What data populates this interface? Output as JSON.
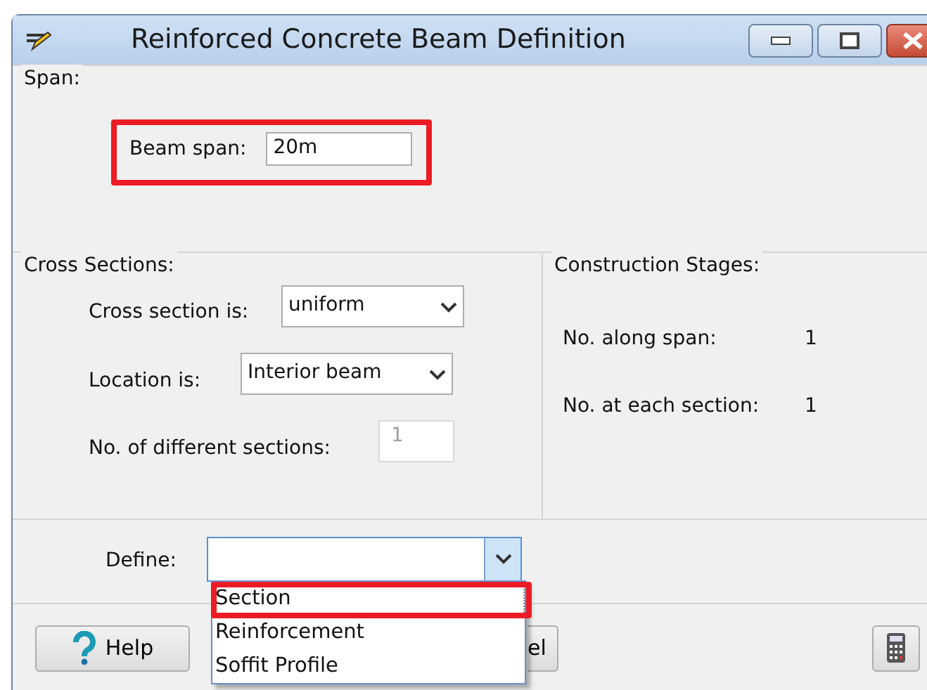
{
  "window": {
    "title": "Reinforced Concrete Beam Definition"
  },
  "span": {
    "legend": "Span:",
    "beam_span_label": "Beam span:",
    "beam_span_value": "20m",
    "highlighted": true
  },
  "cross_sections": {
    "legend": "Cross Sections:",
    "fields": [
      {
        "kind": "select",
        "label": "Cross section is:",
        "value": "uniform"
      },
      {
        "kind": "select",
        "label": "Location is:",
        "value": "Interior beam"
      },
      {
        "kind": "input",
        "label": "No. of different sections:",
        "value": "1",
        "disabled": true
      }
    ]
  },
  "construction_stages": {
    "legend": "Construction Stages:",
    "rows": [
      {
        "label": "No. along span:",
        "value": "1"
      },
      {
        "label": "No. at each section:",
        "value": "1"
      }
    ]
  },
  "define": {
    "label": "Define:",
    "expanded": true,
    "options": [
      {
        "label": "Section",
        "selected": true,
        "highlighted": true
      },
      {
        "label": "Reinforcement",
        "selected": false,
        "highlighted": false
      },
      {
        "label": "Soffit Profile",
        "selected": false,
        "highlighted": false
      }
    ]
  },
  "buttons": [
    {
      "kind": "help",
      "label": "Help"
    },
    {
      "kind": "text",
      "label": "el"
    },
    {
      "kind": "calculator"
    }
  ]
}
